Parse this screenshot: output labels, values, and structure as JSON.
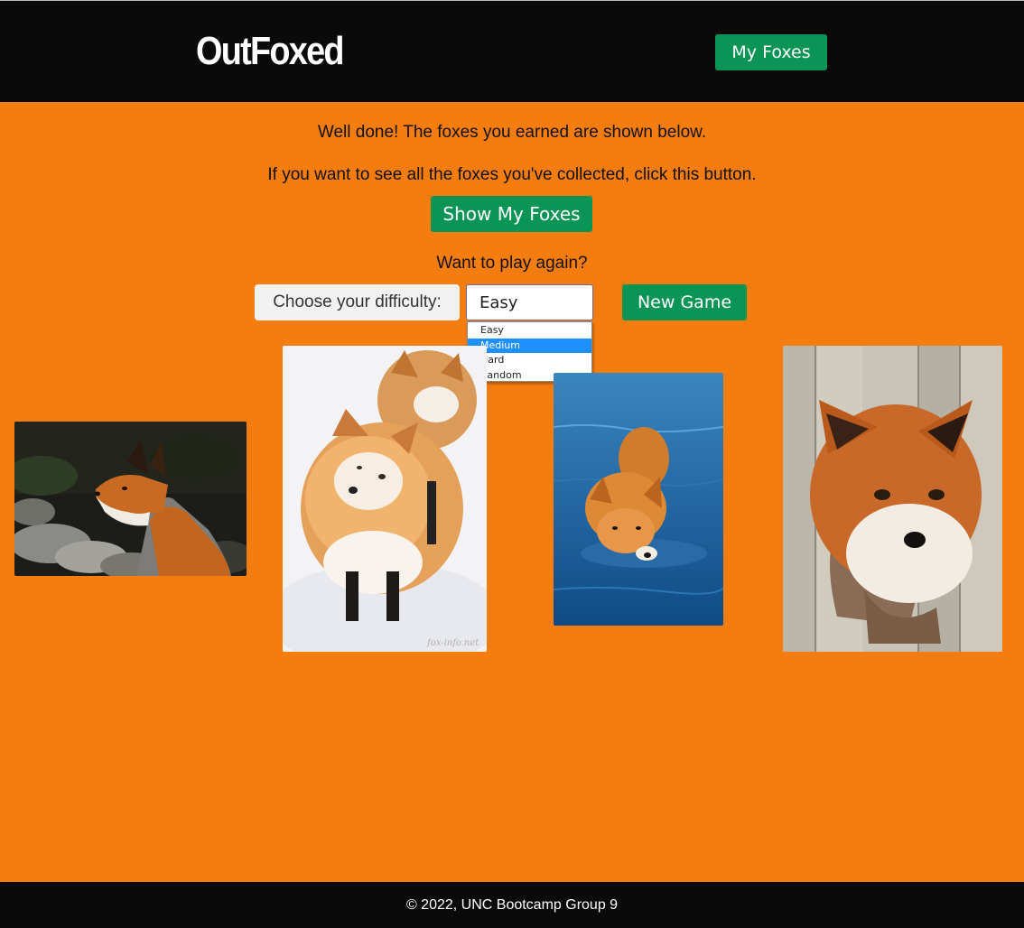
{
  "header": {
    "logo": "OutFoxed",
    "nav_button": "My Foxes"
  },
  "main": {
    "message": "Well done! The foxes you earned are shown below.",
    "collection_prompt": "If you want to see all the foxes you've collected, click this button.",
    "show_button": "Show My Foxes",
    "play_again": "Want to play again?",
    "difficulty_label": "Choose your difficulty:",
    "difficulty_selected": "Easy",
    "difficulty_options": [
      "Easy",
      "Medium",
      "Hard",
      "Random"
    ],
    "highlighted_option": "Medium",
    "new_game_button": "New Game",
    "fox_watermark": "fox-info.net"
  },
  "footer": {
    "copyright": "© 2022, UNC Bootcamp Group 9"
  },
  "colors": {
    "background": "#f57c0f",
    "header": "#0a0a0a",
    "button": "#0a9456",
    "highlight": "#1e90ff"
  }
}
